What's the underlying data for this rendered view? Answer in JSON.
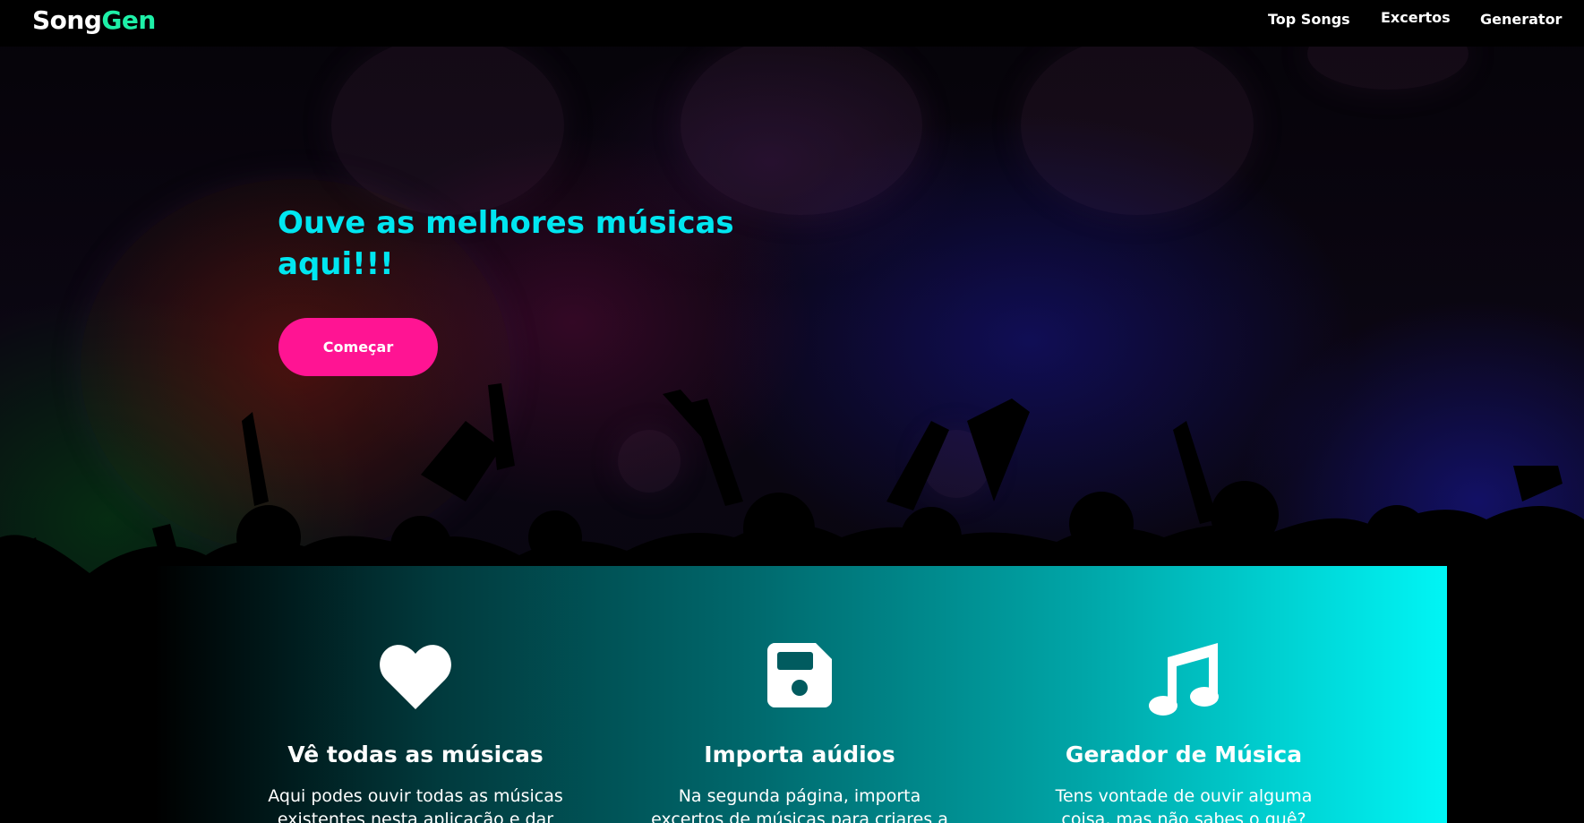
{
  "navbar": {
    "logo_part1": "Song",
    "logo_part2": "Gen",
    "links": [
      {
        "label": "Top Songs"
      },
      {
        "label": "Excertos"
      },
      {
        "label": "Generator"
      }
    ]
  },
  "hero": {
    "title": "Ouve as melhores músicas aqui!!!",
    "button_label": "Começar"
  },
  "features": [
    {
      "icon": "heart-icon",
      "title": "Vê todas as músicas",
      "text": "Aqui podes ouvir todas as músicas existentes nesta aplicação e dar likes"
    },
    {
      "icon": "floppy-disk-icon",
      "title": "Importa aúdios",
      "text": "Na segunda página, importa excertos de músicas para criares a tua própria"
    },
    {
      "icon": "music-note-icon",
      "title": "Gerador de Música",
      "text": "Tens vontade de ouvir alguma coisa, mas não sabes o quê? Escolhe alguma"
    }
  ],
  "colors": {
    "logo_accent": "#1ef0a8",
    "hero_title": "#00e6f0",
    "button_bg": "#ff1493",
    "panel_gradient_end": "#00f5f5"
  }
}
